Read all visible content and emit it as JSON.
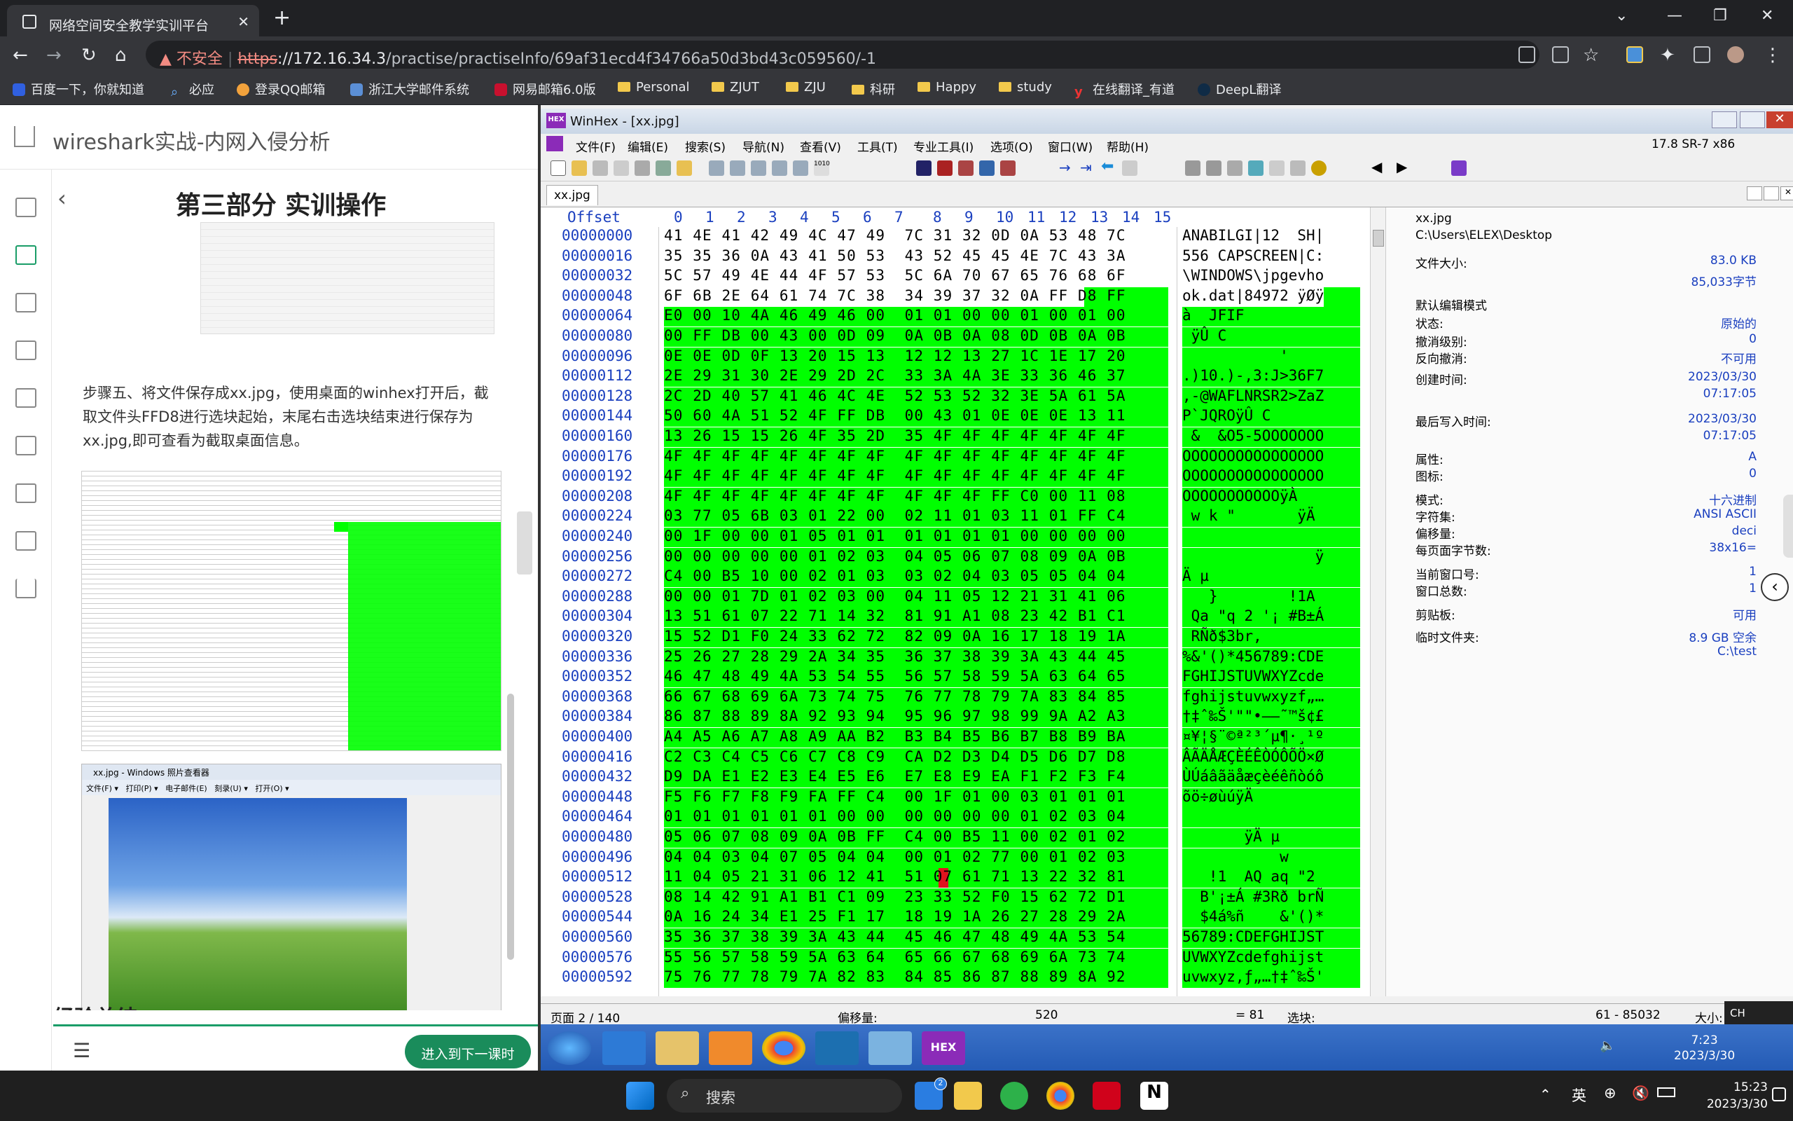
{
  "browser": {
    "tab_title": "网络空间安全教学实训平台",
    "not_secure": "不安全",
    "url_scheme": "https",
    "url_host": "://172.16.34.3",
    "url_path": "/practise/practiseInfo/69af31ecd4f34766a50d3bd43c059560/-1"
  },
  "bookmarks": [
    "百度一下，你就知道",
    "必应",
    "登录QQ邮箱",
    "浙江大学邮件系统",
    "网易邮箱6.0版",
    "Personal",
    "ZJUT",
    "ZJU",
    "科研",
    "Happy",
    "study",
    "在线翻译_有道",
    "DeepL翻译"
  ],
  "left": {
    "header_title": "wireshark实战-内网入侵分析",
    "section_title": "第三部分 实训操作",
    "paragraph": "步骤五、将文件保存成xx.jpg，使用桌面的winhex打开后，截取文件头FFD8进行选块起始，末尾右击选块结束进行保存为xx.jpg,即可查看为截取桌面信息。",
    "next_lesson": "进入到下一课时",
    "partial_heading": "经验总结",
    "viewer_title": "xx.jpg - Windows 照片查看器",
    "viewer_menu": [
      "文件(F) ▾",
      "打印(P) ▾",
      "电子邮件(E)",
      "刻录(U) ▾",
      "打开(O) ▾"
    ]
  },
  "winhex": {
    "title": "WinHex - [xx.jpg]",
    "menu": [
      "文件(F)",
      "编辑(E)",
      "搜索(S)",
      "导航(N)",
      "查看(V)",
      "工具(T)",
      "专业工具(I)",
      "选项(O)",
      "窗口(W)",
      "帮助(H)"
    ],
    "version": "17.8 SR-7 x86",
    "file_tab": "xx.jpg",
    "col_header": "Offset",
    "col_nums": [
      "0",
      "1",
      "2",
      "3",
      "4",
      "5",
      "6",
      "7",
      "8",
      "9",
      "10",
      "11",
      "12",
      "13",
      "14",
      "15"
    ],
    "rows": [
      [
        "00000000",
        "41 4E 41 42 49 4C 47 49  7C 31 32 0D 0A 53 48 7C",
        "ANABILGI|12  SH|"
      ],
      [
        "00000016",
        "35 35 36 0A 43 41 50 53  43 52 45 45 4E 7C 43 3A",
        "556 CAPSCREEN|C:"
      ],
      [
        "00000032",
        "5C 57 49 4E 44 4F 57 53  5C 6A 70 67 65 76 68 6F",
        "\\WINDOWS\\jpgevho"
      ],
      [
        "00000048",
        "6F 6B 2E 64 61 74 7C 38  34 39 37 32 0A FF D8 FF",
        "ok.dat|84972 ÿØÿ"
      ],
      [
        "00000064",
        "E0 00 10 4A 46 49 46 00  01 01 00 00 01 00 01 00",
        "à  JFIF         "
      ],
      [
        "00000080",
        "00 FF DB 00 43 00 0D 09  0A 0B 0A 08 0D 0B 0A 0B",
        " ÿÛ C          "
      ],
      [
        "00000096",
        "0E 0E 0D 0F 13 20 15 13  12 12 13 27 1C 1E 17 20",
        "           '    "
      ],
      [
        "00000112",
        "2E 29 31 30 2E 29 2D 2C  33 3A 4A 3E 33 36 46 37",
        ".)10.)-,3:J>36F7"
      ],
      [
        "00000128",
        "2C 2D 40 57 41 46 4C 4E  52 53 52 32 3E 5A 61 5A",
        ",-@WAFLNRSR2>ZaZ"
      ],
      [
        "00000144",
        "50 60 4A 51 52 4F FF DB  00 43 01 0E 0E 0E 13 11",
        "P`JQROÿÛ C      "
      ],
      [
        "00000160",
        "13 26 15 15 26 4F 35 2D  35 4F 4F 4F 4F 4F 4F 4F",
        " &  &O5-5OOOOOOO"
      ],
      [
        "00000176",
        "4F 4F 4F 4F 4F 4F 4F 4F  4F 4F 4F 4F 4F 4F 4F 4F",
        "OOOOOOOOOOOOOOOO"
      ],
      [
        "00000192",
        "4F 4F 4F 4F 4F 4F 4F 4F  4F 4F 4F 4F 4F 4F 4F 4F",
        "OOOOOOOOOOOOOOOO"
      ],
      [
        "00000208",
        "4F 4F 4F 4F 4F 4F 4F 4F  4F 4F 4F FF C0 00 11 08",
        "OOOOOOOOOOOÿÀ   "
      ],
      [
        "00000224",
        "03 77 05 6B 03 01 22 00  02 11 01 03 11 01 FF C4",
        " w k \"       ÿÄ"
      ],
      [
        "00000240",
        "00 1F 00 00 01 05 01 01  01 01 01 01 00 00 00 00",
        "                "
      ],
      [
        "00000256",
        "00 00 00 00 00 01 02 03  04 05 06 07 08 09 0A 0B",
        "               ÿ"
      ],
      [
        "00000272",
        "C4 00 B5 10 00 02 01 03  03 02 04 03 05 05 04 04",
        "Ä µ             "
      ],
      [
        "00000288",
        "00 00 01 7D 01 02 03 00  04 11 05 12 21 31 41 06",
        "   }        !1A "
      ],
      [
        "00000304",
        "13 51 61 07 22 71 14 32  81 91 A1 08 23 42 B1 C1",
        " Qa \"q 2 '¡ #B±Á"
      ],
      [
        "00000320",
        "15 52 D1 F0 24 33 62 72  82 09 0A 16 17 18 19 1A",
        " RÑð$3br,       "
      ],
      [
        "00000336",
        "25 26 27 28 29 2A 34 35  36 37 38 39 3A 43 44 45",
        "%&'()*456789:CDE"
      ],
      [
        "00000352",
        "46 47 48 49 4A 53 54 55  56 57 58 59 5A 63 64 65",
        "FGHIJSTUVWXYZcde"
      ],
      [
        "00000368",
        "66 67 68 69 6A 73 74 75  76 77 78 79 7A 83 84 85",
        "fghijstuvwxyzf„…"
      ],
      [
        "00000384",
        "86 87 88 89 8A 92 93 94  95 96 97 98 99 9A A2 A3",
        "†‡ˆ‰Š'\"\"•–—˜™š¢£"
      ],
      [
        "00000400",
        "A4 A5 A6 A7 A8 A9 AA B2  B3 B4 B5 B6 B7 B8 B9 BA",
        "¤¥¦§¨©ª²³´µ¶·¸¹º"
      ],
      [
        "00000416",
        "C2 C3 C4 C5 C6 C7 C8 C9  CA D2 D3 D4 D5 D6 D7 D8",
        "ÂÃÄÅÆÇÈÉÊÒÓÔÕÖ×Ø"
      ],
      [
        "00000432",
        "D9 DA E1 E2 E3 E4 E5 E6  E7 E8 E9 EA F1 F2 F3 F4",
        "ÙÚáâãäåæçèéêñòóô"
      ],
      [
        "00000448",
        "F5 F6 F7 F8 F9 FA FF C4  00 1F 01 00 03 01 01 01",
        "õö÷øùúÿÄ        "
      ],
      [
        "00000464",
        "01 01 01 01 01 01 00 00  00 00 00 00 01 02 03 04",
        "                "
      ],
      [
        "00000480",
        "05 06 07 08 09 0A 0B FF  C4 00 B5 11 00 02 01 02",
        "       ÿÄ µ     "
      ],
      [
        "00000496",
        "04 04 03 04 07 05 04 04  00 01 02 77 00 01 02 03",
        "           w    "
      ],
      [
        "00000512",
        "11 04 05 21 31 06 12 41  51 07 61 71 13 22 32 81",
        "   !1  AQ aq \"2 "
      ],
      [
        "00000528",
        "08 14 42 91 A1 B1 C1 09  23 33 52 F0 15 62 72 D1",
        "  B'¡±Á #3Rð brÑ"
      ],
      [
        "00000544",
        "0A 16 24 34 E1 25 F1 17  18 19 1A 26 27 28 29 2A",
        "  $4á%ñ    &'()*"
      ],
      [
        "00000560",
        "35 36 37 38 39 3A 43 44  45 46 47 48 49 4A 53 54",
        "56789:CDEFGHIJST"
      ],
      [
        "00000576",
        "55 56 57 58 59 5A 63 64  65 66 67 68 69 6A 73 74",
        "UVWXYZcdefghijst"
      ],
      [
        "00000592",
        "75 76 77 78 79 7A 82 83  84 85 86 87 88 89 8A 92",
        "uvwxyz‚ƒ„…†‡ˆ‰Š'"
      ]
    ],
    "info": [
      [
        "xx.jpg",
        ""
      ],
      [
        "C:\\Users\\ELEX\\Desktop",
        ""
      ],
      [
        "文件大小:",
        "83.0 KB"
      ],
      [
        "",
        "85,033字节"
      ],
      [
        "默认编辑模式",
        ""
      ],
      [
        "状态:",
        "原始的"
      ],
      [
        "撤消级别:",
        "0"
      ],
      [
        "反向撤消:",
        "不可用"
      ],
      [
        "创建时间:",
        "2023/03/30"
      ],
      [
        "",
        "07:17:05"
      ],
      [
        "最后写入时间:",
        "2023/03/30"
      ],
      [
        "",
        "07:17:05"
      ],
      [
        "属性:",
        "A"
      ],
      [
        "图标:",
        "0"
      ],
      [
        "模式:",
        "十六进制"
      ],
      [
        "字符集:",
        "ANSI ASCII"
      ],
      [
        "偏移量:",
        "deci"
      ],
      [
        "每页面字节数:",
        "38x16="
      ],
      [
        "当前窗口号:",
        "1"
      ],
      [
        "窗口总数:",
        "1"
      ],
      [
        "剪贴板:",
        "可用"
      ],
      [
        "临时文件夹:",
        "8.9 GB 空余"
      ],
      [
        "",
        "C:\\test"
      ]
    ],
    "status": {
      "page": "页面 2 / 140",
      "offset_label": "偏移量:",
      "offset_value": "520",
      "equals": "= 81",
      "block_label": "选块:",
      "block_value": "61 - 85032",
      "size_label": "大小:"
    },
    "xp_clock": {
      "time": "7:23",
      "date": "2023/3/30"
    },
    "xp_lang": "CH"
  },
  "taskbar": {
    "search": "搜索",
    "time": "15:23",
    "date": "2023/3/30",
    "ime": "英",
    "badge": "2"
  },
  "colors": {
    "selection": "#00ff00",
    "offset_blue": "#1a3fbf",
    "next_btn": "#1a8c5b"
  }
}
